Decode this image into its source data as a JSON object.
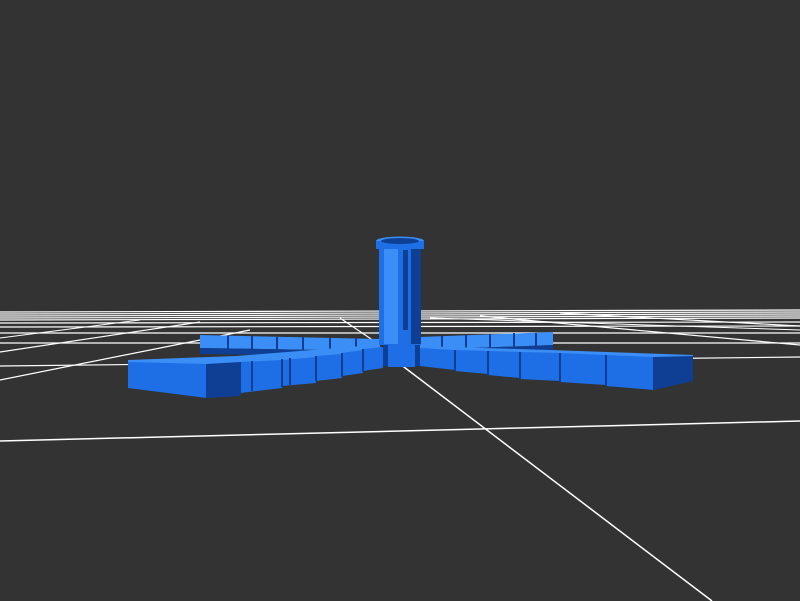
{
  "viewer": {
    "background_color": "#333333",
    "grid_color": "#ffffff",
    "model_color": "#1e6fe6",
    "model_dark_color": "#0e3f95",
    "model_light_color": "#3b8ef5",
    "model": "radial-grid-holder"
  }
}
